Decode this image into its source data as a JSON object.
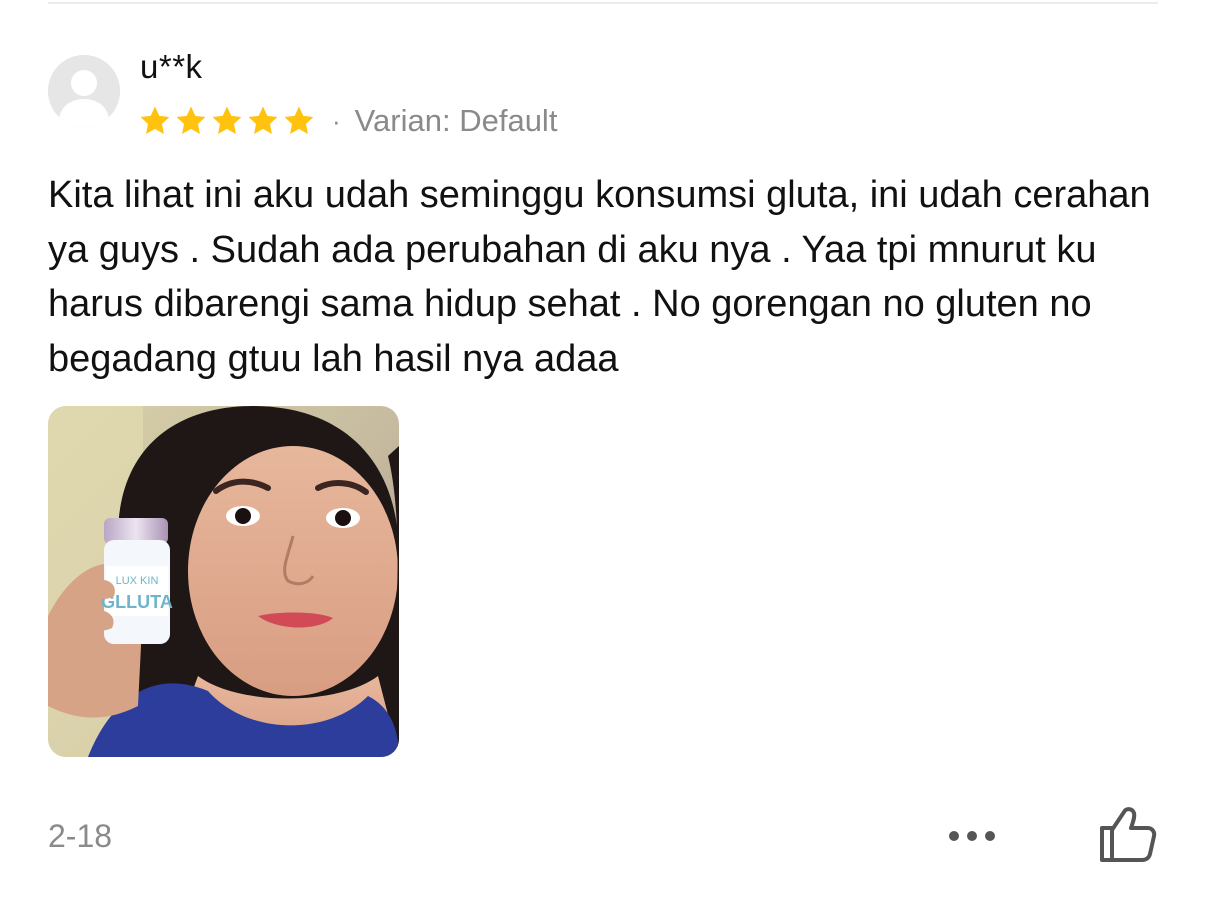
{
  "review": {
    "username": "u**k",
    "rating": 5,
    "rating_max": 5,
    "separator": "·",
    "variant": "Varian: Default",
    "text": "Kita lihat ini aku udah seminggu konsumsi gluta, ini udah cerahan ya guys . Sudah ada perubahan di aku nya . Yaa tpi mnurut ku harus dibarengi sama hidup sehat . No gorengan no gluten no begadang gtuu lah hasil nya adaa",
    "date": "2-18",
    "photo": {
      "product_label_lines": [
        "LUX KIN",
        "GLLUTA"
      ]
    }
  },
  "icons": {
    "avatar": "default-user-icon",
    "star": "star-icon",
    "more": "more-horizontal-icon",
    "like": "thumbs-up-icon"
  },
  "colors": {
    "star": "#FFC20E",
    "muted_text": "#8A8A8A",
    "body_text": "#111111",
    "avatar_bg": "#E6E6E6",
    "icon_gray": "#555555"
  }
}
